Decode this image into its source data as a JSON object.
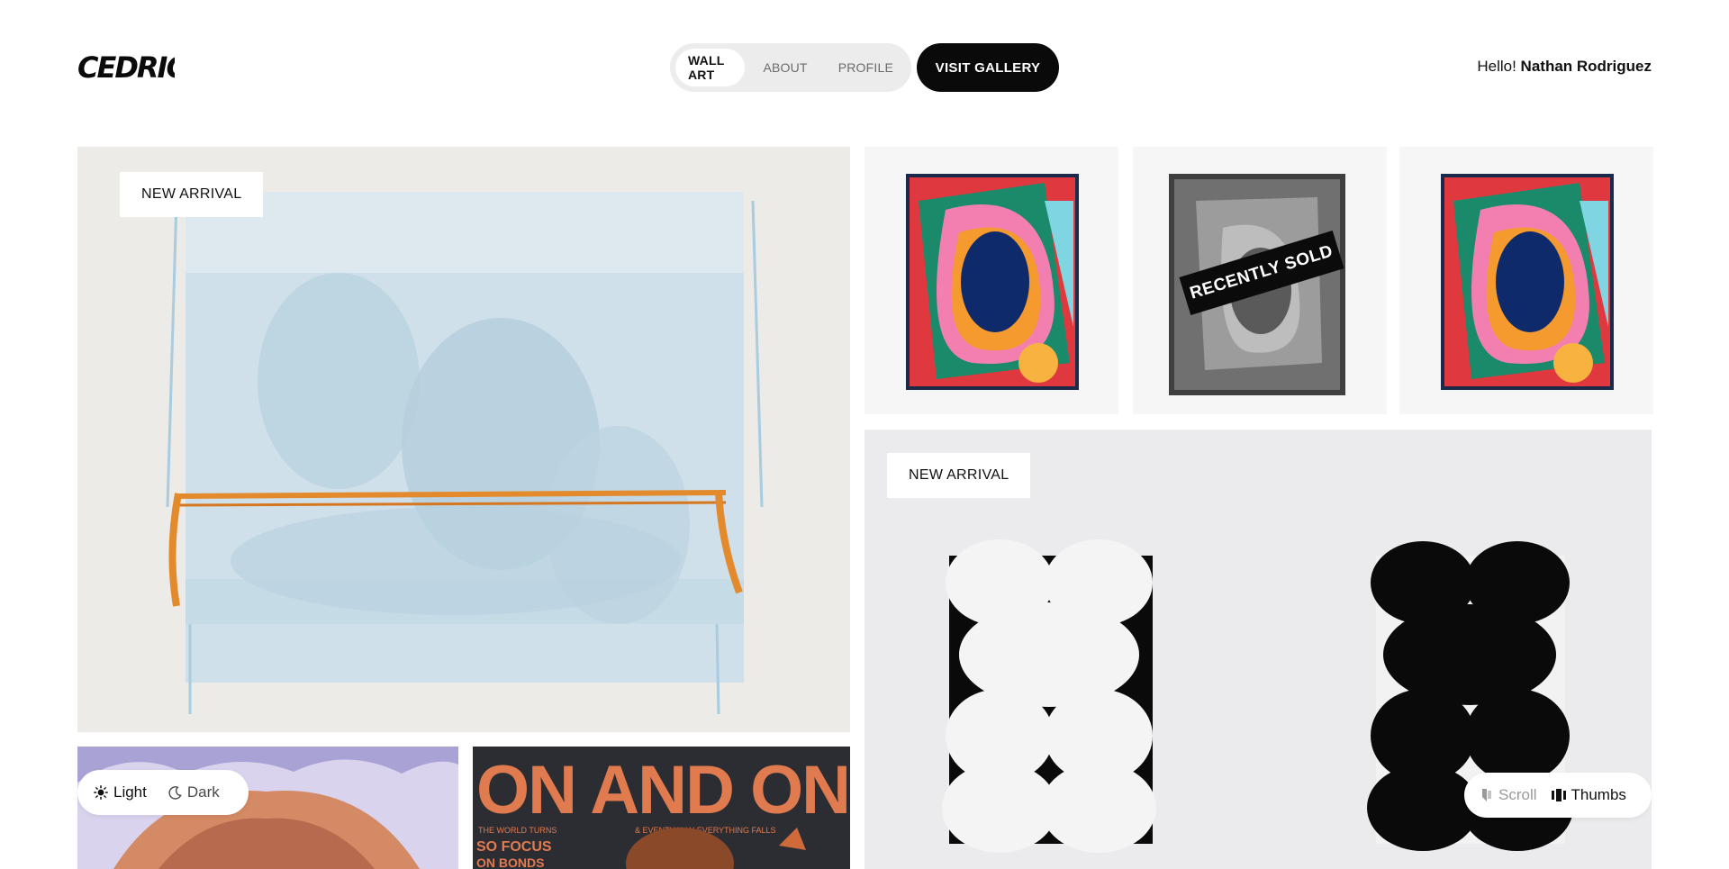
{
  "header": {
    "logo_text": "CEDRIC",
    "nav": [
      {
        "label": "WALL ART",
        "active": true
      },
      {
        "label": "ABOUT",
        "active": false
      },
      {
        "label": "PROFILE",
        "active": false
      }
    ],
    "visit_button": "VISIT GALLERY",
    "greeting_prefix": "Hello!",
    "user_name": "Nathan Rodriguez"
  },
  "tiles": {
    "big": {
      "badge": "NEW ARRIVAL"
    },
    "small_a": {
      "status": ""
    },
    "small_b": {
      "status": "RECENTLY SOLD"
    },
    "small_c": {
      "status": ""
    },
    "wide": {
      "badge": "NEW ARRIVAL"
    },
    "bottom_left": {},
    "bottom_right": {
      "poster_text": "ON AND ON",
      "poster_sub_1": "THE WORLD TURNS",
      "poster_sub_2": "& EVENTUALLY EVERYTHING FALLS",
      "poster_sub_3": "SO FOCUS",
      "poster_sub_4": "ON BONDS"
    }
  },
  "theme_toggle": {
    "light_label": "Light",
    "dark_label": "Dark",
    "light_icon": "sun-icon",
    "dark_icon": "moon-icon"
  },
  "view_toggle": {
    "scroll_label": "Scroll",
    "thumbs_label": "Thumbs",
    "scroll_icon": "scroll-icon",
    "thumbs_icon": "thumbs-icon"
  },
  "colors": {
    "accent": "#0a0a0a",
    "nav_pill_bg": "#ececec",
    "muted_text": "#9a9a9a"
  }
}
